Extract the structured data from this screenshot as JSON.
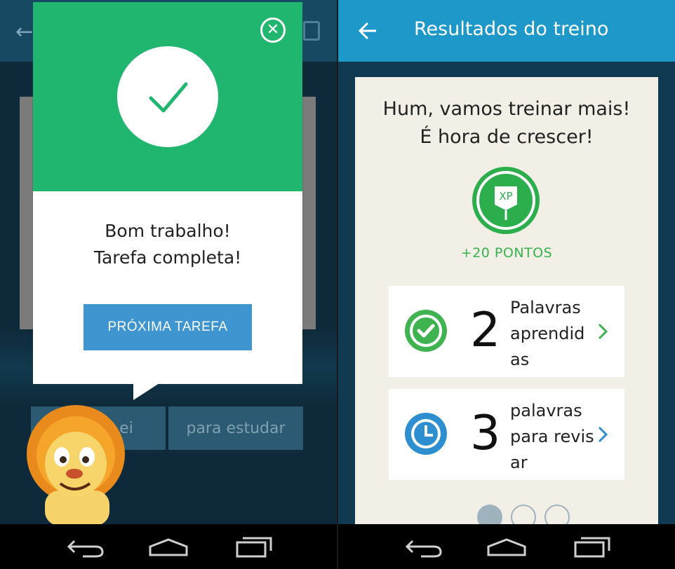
{
  "left_screen": {
    "dialog": {
      "message_line1": "Bom trabalho!",
      "message_line2": "Tarefa completa!",
      "next_button": "PRÓXIMA TAREFA",
      "accent_color": "#21b66f",
      "button_color": "#3e95d0"
    },
    "background_buttons": {
      "button_a_label": "ei",
      "button_b_label": "para estudar"
    },
    "icons": [
      "back-arrow-icon",
      "add-card-icon",
      "close-icon",
      "checkmark-icon",
      "lion-mascot"
    ]
  },
  "right_screen": {
    "appbar": {
      "title": "Resultados do treino",
      "color": "#1e98c8"
    },
    "message_line1": "Hum, vamos treinar mais!",
    "message_line2": "É hora de crescer!",
    "xp_badge_text": "XP",
    "points": "+20 PONTOS",
    "stats": [
      {
        "number": "2",
        "label": "Palavras aprendidas",
        "icon": "check-circle-icon",
        "color": "#3fb34f"
      },
      {
        "number": "3",
        "label": "palavras para revisar",
        "icon": "clock-icon",
        "color": "#2e8fd0"
      }
    ]
  },
  "navigation": [
    "back-nav-icon",
    "home-nav-icon",
    "recents-nav-icon"
  ]
}
